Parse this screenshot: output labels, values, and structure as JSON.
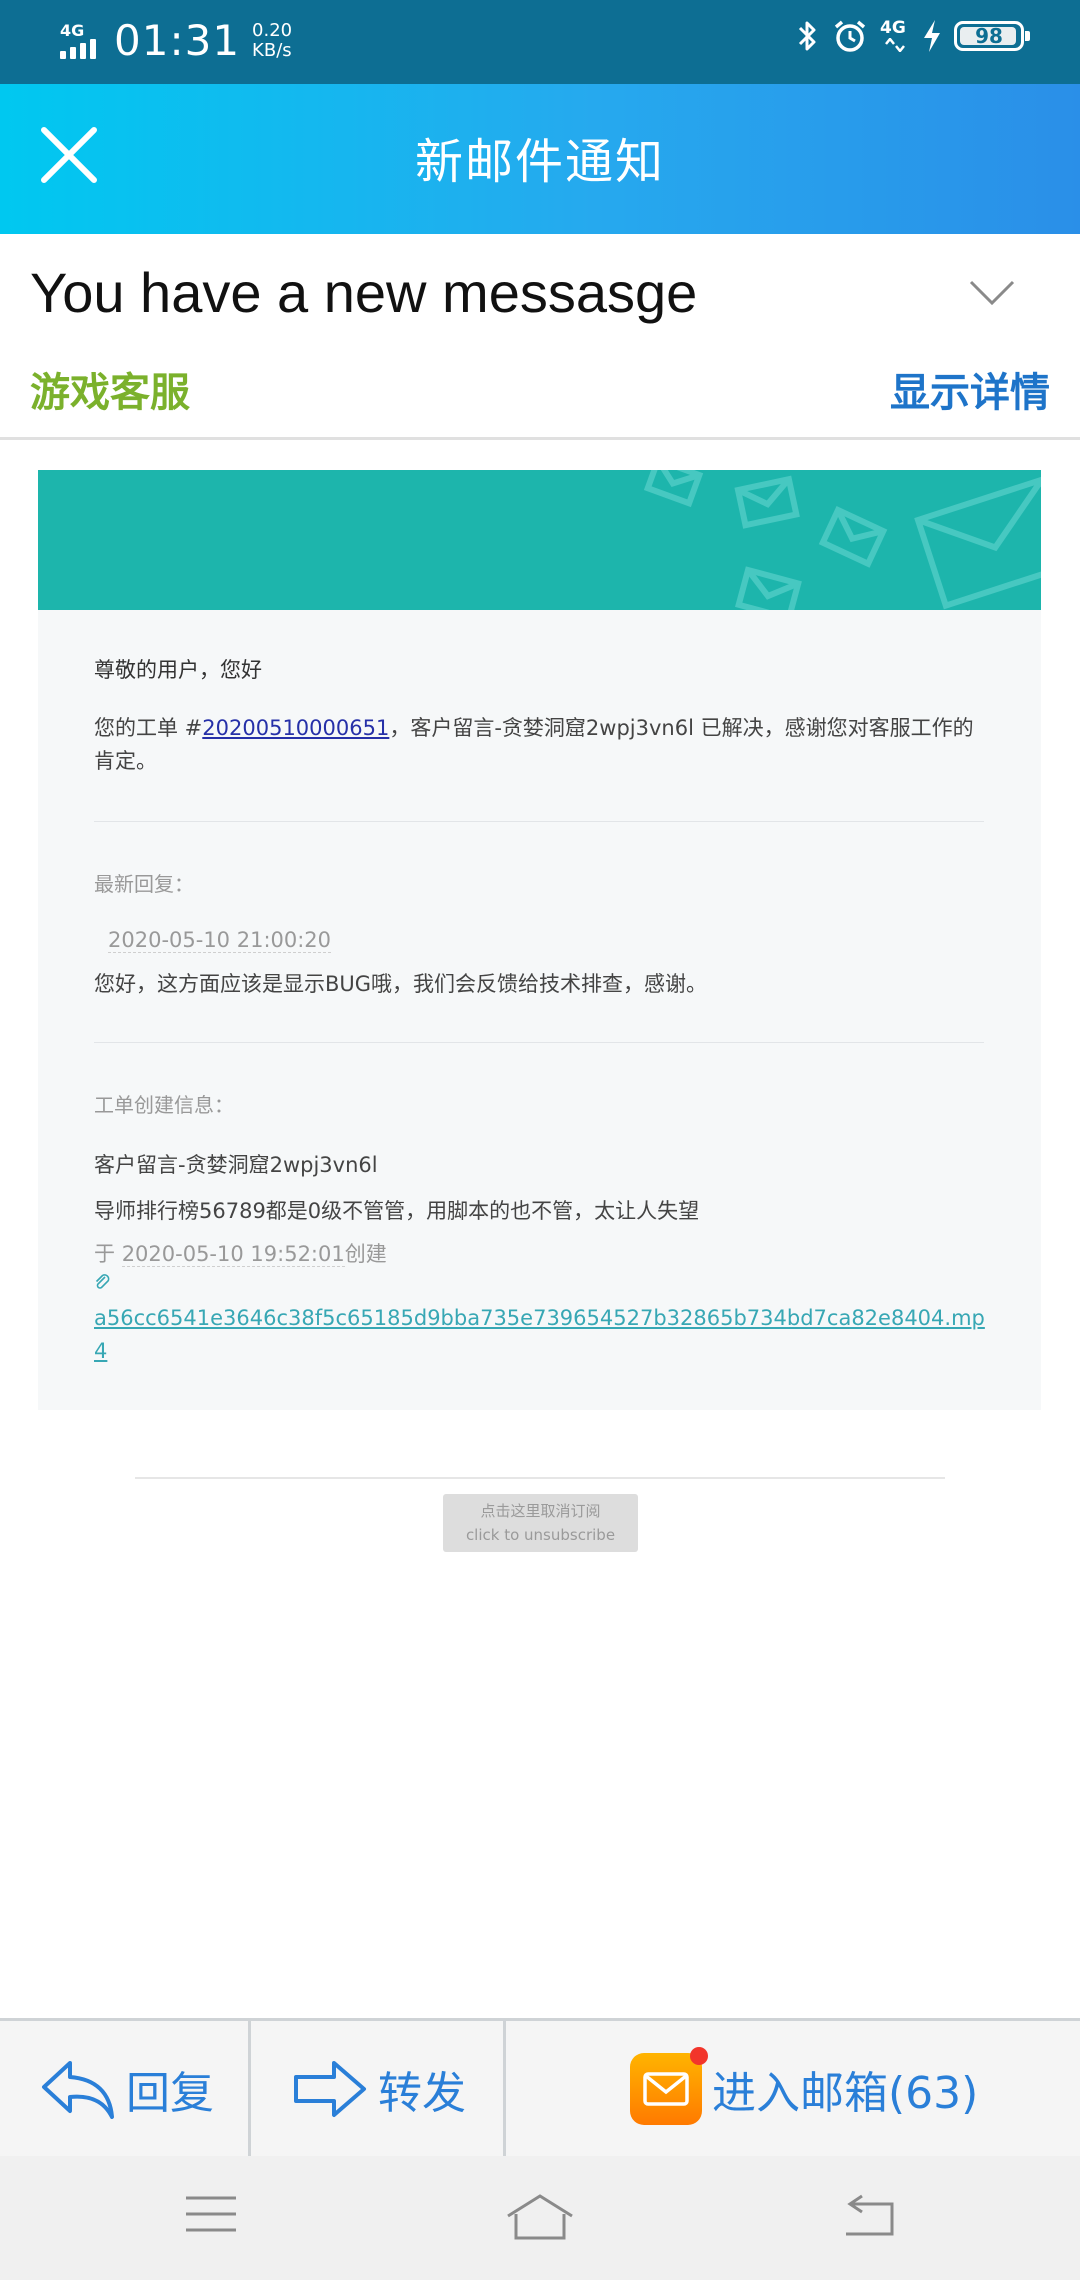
{
  "status_bar": {
    "network": "4G",
    "time": "01:31",
    "speed_value": "0.20",
    "speed_unit": "KB/s",
    "network_right": "4G",
    "battery": "98",
    "icons": [
      "bluetooth-icon",
      "alarm-icon",
      "mobile-data-icon",
      "charging-icon",
      "battery-icon"
    ]
  },
  "header": {
    "title": "新邮件通知",
    "close_icon": "close-icon"
  },
  "message": {
    "subject": "You have a new messasge",
    "sender": "游戏客服",
    "show_details": "显示详情"
  },
  "email": {
    "greeting": "尊敬的用户，您好",
    "ticket_prefix": "您的工单 #",
    "ticket_number": "20200510000651",
    "ticket_suffix": "，客户留言-贪婪洞窟2wpj3vn6l 已解决，感谢您对客服工作的肯定。",
    "latest_reply_label": "最新回复：",
    "reply_time": "2020-05-10 21:00:20",
    "reply_text": "您好，这方面应该是显示BUG哦，我们会反馈给技术排查，感谢。",
    "creation_info_label": "工单创建信息：",
    "creation_title": "客户留言-贪婪洞窟2wpj3vn6l",
    "creation_text": "导师排行榜56789都是0级不管管，用脚本的也不管，太让人失望",
    "created_prefix": "于",
    "created_datetime": "2020-05-10 19:52:01",
    "created_suffix": "创建",
    "attachment": "a56cc6541e3646c38f5c65185d9bba735e739654527b32865b734bd7ca82e8404.mp4"
  },
  "unsubscribe": {
    "line1": "点击这里取消订阅",
    "line2": "click to unsubscribe"
  },
  "actions": {
    "reply": "回复",
    "forward": "转发",
    "inbox": "进入邮箱(63)"
  },
  "colors": {
    "header_start": "#00c8f0",
    "header_end": "#2a8fe8",
    "sender": "#7bb12c",
    "link_blue": "#1e74c9",
    "banner": "#1db5ac",
    "attachment_link": "#37a7b4"
  }
}
